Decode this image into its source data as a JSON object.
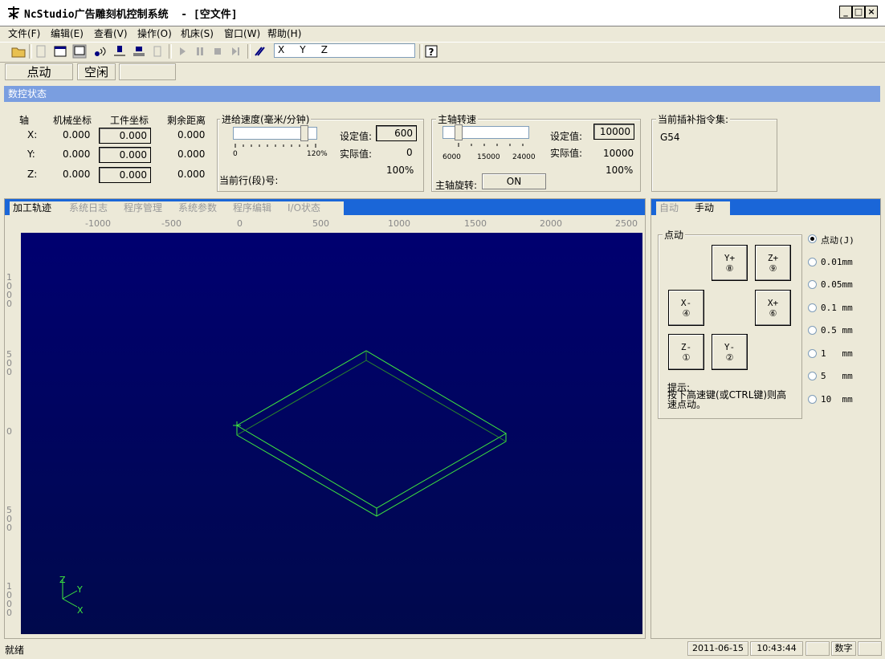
{
  "window": {
    "title": "NcStudio广告雕刻机控制系统  - [空文件]",
    "minimize": "_",
    "maximize": "□",
    "close": "×"
  },
  "menu": [
    "文件(F)",
    "编辑(E)",
    "查看(V)",
    "操作(O)",
    "机床(S)",
    "窗口(W)",
    "帮助(H)"
  ],
  "toolbar": {
    "command_input": "X     Y     Z"
  },
  "mode": {
    "jog": "点动",
    "state": "空闲",
    "extra": ""
  },
  "nc_status": {
    "header": "数控状态",
    "cols": {
      "axis": "轴",
      "machine": "机械坐标",
      "work": "工件坐标",
      "remain": "剩余距离"
    },
    "rows": [
      {
        "axis": "X:",
        "machine": "0.000",
        "work": "0.000",
        "remain": "0.000"
      },
      {
        "axis": "Y:",
        "machine": "0.000",
        "work": "0.000",
        "remain": "0.000"
      },
      {
        "axis": "Z:",
        "machine": "0.000",
        "work": "0.000",
        "remain": "0.000"
      }
    ],
    "feed": {
      "title": "进给速度(毫米/分钟)",
      "slider_min": "0",
      "slider_max": "120%",
      "set_label": "设定值:",
      "set_value": "600",
      "actual_label": "实际值:",
      "actual_value": "0",
      "percent": "100%",
      "line_label": "当前行(段)号:"
    },
    "spindle": {
      "title": "主轴转速",
      "ticks": [
        "6000",
        "15000",
        "24000"
      ],
      "set_label": "设定值:",
      "set_value": "10000",
      "actual_label": "实际值:",
      "actual_value": "10000",
      "percent": "100%",
      "rotate_label": "主轴旋转:",
      "rotate_button": "ON"
    },
    "interp": {
      "title": "当前插补指令集:",
      "value": "G54"
    }
  },
  "left_tabs": [
    "加工轨迹",
    "系统日志",
    "程序管理",
    "系统参数",
    "程序编辑",
    "I/O状态"
  ],
  "ruler_x": [
    "-1000",
    "-500",
    "0",
    "500",
    "1000",
    "1500",
    "2000",
    "2500"
  ],
  "ruler_y": [
    "1000",
    "500",
    "0",
    "500",
    "1000"
  ],
  "axis_labels": {
    "z": "Z",
    "y": "Y",
    "x": "X"
  },
  "right_tabs": [
    "自动",
    "手动"
  ],
  "jog": {
    "group_title": "点动",
    "buttons": {
      "yplus": [
        "Y+",
        "⑧"
      ],
      "zplus": [
        "Z+",
        "⑨"
      ],
      "xminus": [
        "X-",
        "④"
      ],
      "xplus": [
        "X+",
        "⑥"
      ],
      "zminus": [
        "Z-",
        "①"
      ],
      "yminus": [
        "Y-",
        "②"
      ]
    },
    "tip_title": "提示:",
    "tip_text": "按下高速键(或CTRL键)则高速点动。",
    "steps": [
      "点动(J)",
      "0.01mm",
      "0.05mm",
      "0.1 mm",
      "0.5 mm",
      "1   mm",
      "5   mm",
      "10  mm"
    ],
    "selected_step": 0
  },
  "statusbar": {
    "ready": "就绪",
    "date": "2011-06-15",
    "time": "10:43:44",
    "blank": "",
    "num": "数字",
    "blank2": ""
  }
}
